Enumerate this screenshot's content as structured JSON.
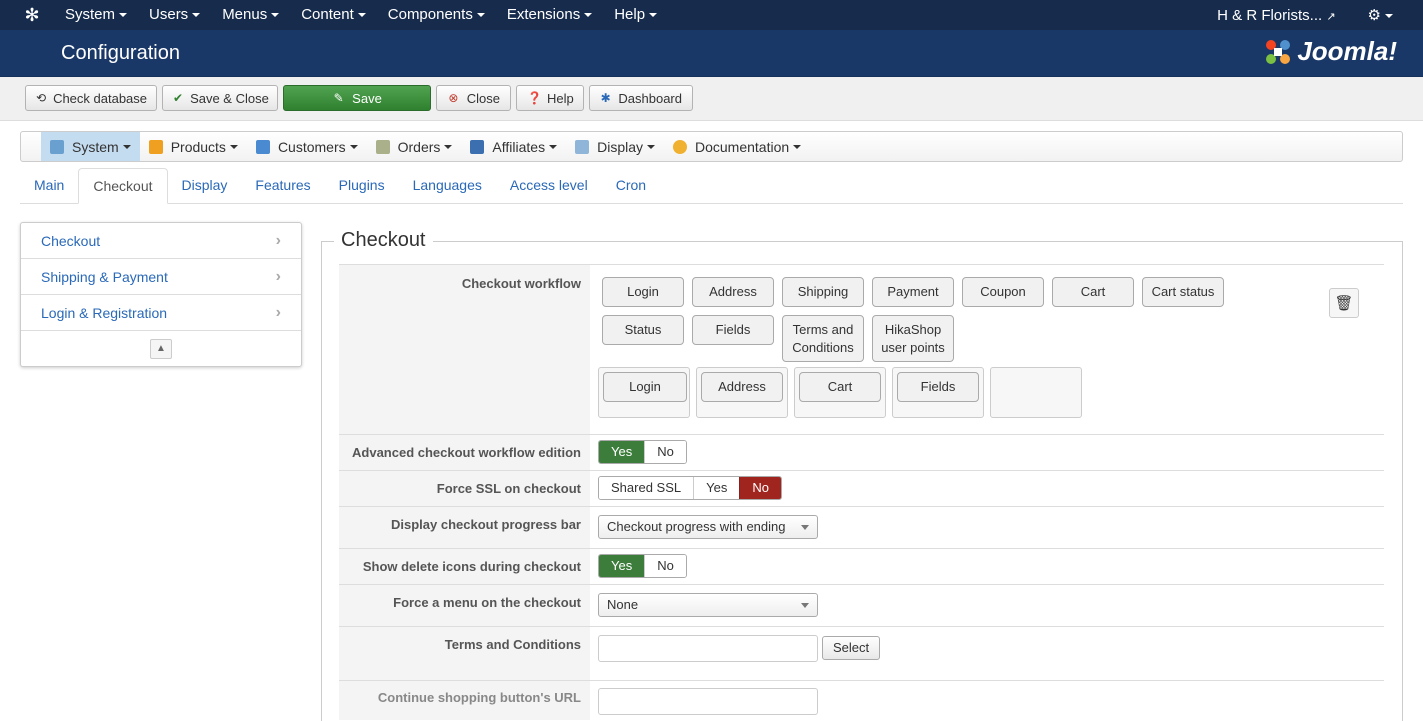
{
  "topbar": {
    "menu": [
      "System",
      "Users",
      "Menus",
      "Content",
      "Components",
      "Extensions",
      "Help"
    ],
    "site_name": "H & R Florists...",
    "settings_icon": "gear-icon"
  },
  "header": {
    "title": "Configuration",
    "brand": "Joomla!"
  },
  "toolbar": {
    "check_database": "Check database",
    "save_close": "Save & Close",
    "save": "Save",
    "close": "Close",
    "help": "Help",
    "dashboard": "Dashboard"
  },
  "hnav": {
    "items": [
      "System",
      "Products",
      "Customers",
      "Orders",
      "Affiliates",
      "Display",
      "Documentation"
    ]
  },
  "tabs": [
    "Main",
    "Checkout",
    "Display",
    "Features",
    "Plugins",
    "Languages",
    "Access level",
    "Cron"
  ],
  "sidemenu": [
    "Checkout",
    "Shipping & Payment",
    "Login & Registration"
  ],
  "section": {
    "legend": "Checkout"
  },
  "fields": {
    "workflow_label": "Checkout workflow",
    "workflow_available": [
      "Login",
      "Address",
      "Shipping",
      "Payment",
      "Coupon",
      "Cart",
      "Cart status",
      "Status",
      "Fields",
      "Terms and Conditions",
      "HikaShop user points"
    ],
    "workflow_step": [
      "Login",
      "Address",
      "Cart",
      "Fields"
    ],
    "advanced_label": "Advanced checkout workflow edition",
    "advanced_options": [
      "Yes",
      "No"
    ],
    "advanced_selected": "Yes",
    "ssl_label": "Force SSL on checkout",
    "ssl_options": [
      "Shared SSL",
      "Yes",
      "No"
    ],
    "ssl_selected": "No",
    "progress_label": "Display checkout progress bar",
    "progress_value": "Checkout progress with ending",
    "delete_icons_label": "Show delete icons during checkout",
    "delete_icons_options": [
      "Yes",
      "No"
    ],
    "delete_icons_selected": "Yes",
    "menu_label": "Force a menu on the checkout",
    "menu_value": "None",
    "terms_label": "Terms and Conditions",
    "terms_value": "",
    "terms_button": "Select",
    "continue_label": "Continue shopping button's URL",
    "continue_value": ""
  }
}
